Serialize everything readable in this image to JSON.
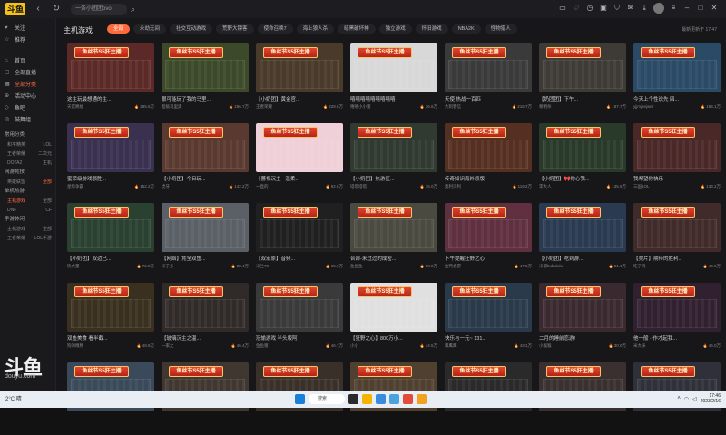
{
  "topbar": {
    "logo": "斗鱼",
    "search_placeholder": "一条小团团ovo",
    "search_icon": "search-icon",
    "icons": [
      "restore-icon",
      "heart-icon",
      "history-icon",
      "gift-icon",
      "shirt-icon",
      "message-icon",
      "download-icon",
      "avatar",
      "more-icon",
      "minimize-icon",
      "maximize-icon",
      "close-icon"
    ]
  },
  "sidebar": {
    "items": [
      {
        "label": "关注",
        "icon": "heart-icon"
      },
      {
        "label": "推荐",
        "icon": "star-icon"
      },
      {
        "label": "首页",
        "icon": "home-icon"
      },
      {
        "label": "全部直播",
        "icon": "tv-icon"
      },
      {
        "label": "全部分类",
        "icon": "grid-icon"
      },
      {
        "label": "活动中心",
        "icon": "gift-icon"
      },
      {
        "label": "鱼吧",
        "icon": "fish-icon"
      },
      {
        "label": "鼓舞组",
        "icon": "group-icon"
      }
    ],
    "group1": "常用分类",
    "rows1": [
      [
        "和平精英",
        "LOL"
      ],
      [
        "王者荣耀",
        "二次元"
      ],
      [
        "DOTA2",
        "主机"
      ]
    ],
    "group2": "网游竞技",
    "rows2": [
      [
        "英雄联盟",
        "全部"
      ]
    ],
    "group3": "单机热游",
    "rows3": [
      [
        "主机游戏",
        "全部"
      ],
      [
        "DNF",
        "CF"
      ]
    ],
    "group4": "手游休闲",
    "rows4": [
      [
        "主机游戏",
        "全部"
      ],
      [
        "王者荣耀",
        "LOL手游"
      ]
    ],
    "brand": "斗鱼",
    "brand_sub": "douyu.com"
  },
  "main": {
    "section_title": "主机游戏",
    "tabs": [
      "全部",
      "永劫无间",
      "社交互动游戏",
      "荒野大镖客",
      "使命召唤7",
      "海上狼人杀",
      "暗黑破坏神",
      "独立游戏",
      "怀旧游戏",
      "NBA2K",
      "怪物猎人"
    ],
    "update_text": "最新更新于 17:47",
    "banner_text": "鱼丝节S5狂主播"
  },
  "cards": [
    {
      "title": "这主玩最想通的主...",
      "sub": "天官赐福",
      "views": "285.5万",
      "bg": "#5b2a28"
    },
    {
      "title": "狠可能玩了我的马里...",
      "sub": "超级马里奥",
      "views": "256.7万",
      "bg": "#3d4a2a"
    },
    {
      "title": "【小奶团】黄金官...",
      "sub": "王者荣耀",
      "views": "228.6万",
      "bg": "#4a3a2a"
    },
    {
      "title": "嘻嘻嘻嘻嘻嘻嘻嘻嘻",
      "sub": "嘻嘻小小猪",
      "views": "36.6万",
      "bg": "#d8d8d8"
    },
    {
      "title": "天使 热战一百匹",
      "sub": "大刺客信",
      "views": "216.7万",
      "bg": "#3a3a3a"
    },
    {
      "title": "【奶团团】下午...",
      "sub": "黎明杀",
      "views": "197.7万",
      "bg": "#3e3a36"
    },
    {
      "title": "今天上个性说先 四...",
      "sub": "yjjmjeejwer",
      "views": "183.1万",
      "bg": "#2a4a66"
    },
    {
      "title": "蜜荣级游戏额胜...",
      "sub": "星际争霸",
      "views": "152.2万",
      "bg": "#3a3050"
    },
    {
      "title": "【小奶团】今日玩...",
      "sub": "虎牙",
      "views": "142.2万",
      "bg": "#5a3a30"
    },
    {
      "title": "【蔷视沉主 - 温柔...",
      "sub": "一直的",
      "views": "92.6万",
      "bg": "#f0d0d8"
    },
    {
      "title": "【小奶团】热游区...",
      "sub": "塔塔塔塔",
      "views": "75.0万",
      "bg": "#303a30"
    },
    {
      "title": "传奇知识海外原版",
      "sub": "奥利贝利",
      "views": "119.2万",
      "bg": "#553022"
    },
    {
      "title": "【小奶团】🎀你心我...",
      "sub": "李大人",
      "views": "135.5万",
      "bg": "#2a3a2a"
    },
    {
      "title": "我希望你快乐",
      "sub": "三国LOL",
      "views": "133.2万",
      "bg": "#4a2828"
    },
    {
      "title": "【小奶团】双边已...",
      "sub": "快大量",
      "views": "72.8万",
      "bg": "#2a4030"
    },
    {
      "title": "【网络】竞全双鱼...",
      "sub": "米丁多",
      "views": "88.4万",
      "bg": "#5a6066"
    },
    {
      "title": "【双宏原】音频...",
      "sub": "米兰70",
      "views": "65.6万",
      "bg": "#202020"
    },
    {
      "title": "合部-米过过的成密...",
      "sub": "鱼鱼鱼",
      "views": "53.8万",
      "bg": "#4a4a40"
    },
    {
      "title": "下午提醒狂野之心",
      "sub": "鱼鸭会游",
      "views": "47.5万",
      "bg": "#603040"
    },
    {
      "title": "【小奶团】吃到游...",
      "sub": "米都bubululu",
      "views": "51.1万",
      "bg": "#2a3a50"
    },
    {
      "title": "【莞片】期待的胜利...",
      "sub": "吃了鸡",
      "views": "40.6万",
      "bg": "#402a2a"
    },
    {
      "title": "双鱼美食 看半截...",
      "sub": "狗的精胖",
      "views": "48.8万",
      "bg": "#3a3020"
    },
    {
      "title": "【玻璃沉主之温...",
      "sub": "一家之",
      "views": "46.4万",
      "bg": "#302a28"
    },
    {
      "title": "冠愉游戏 半头版阿",
      "sub": "鱼鱼猪",
      "views": "46.7万",
      "bg": "#3a3a3a"
    },
    {
      "title": "【狂野之心】800万小...",
      "sub": "小小",
      "views": "44.5万",
      "bg": "#e0e0e0"
    },
    {
      "title": "快乐与一元~ 131...",
      "sub": "鹰鹰鹰",
      "views": "43.1万",
      "bg": "#2a3a4a"
    },
    {
      "title": "二月的睡前恋游!",
      "sub": "小猴猴",
      "views": "30.0万",
      "bg": "#3a2a30"
    },
    {
      "title": "他一般 · 作才起我...",
      "sub": "米大米",
      "views": "46.0万",
      "bg": "#302030"
    },
    {
      "title": "",
      "sub": "",
      "views": "",
      "bg": "#3a4a5a"
    },
    {
      "title": "",
      "sub": "",
      "views": "",
      "bg": "#403830"
    },
    {
      "title": "",
      "sub": "",
      "views": "",
      "bg": "#3a302a"
    },
    {
      "title": "",
      "sub": "",
      "views": "",
      "bg": "#504030"
    },
    {
      "title": "",
      "sub": "",
      "views": "",
      "bg": "#2a2a2a"
    },
    {
      "title": "",
      "sub": "",
      "views": "",
      "bg": "#3a3030"
    },
    {
      "title": "",
      "sub": "",
      "views": "",
      "bg": "#30303a"
    }
  ],
  "taskbar": {
    "weather": "2°C 晴",
    "search_label": "搜索",
    "time": "17:46",
    "date": "2023/2/16"
  }
}
